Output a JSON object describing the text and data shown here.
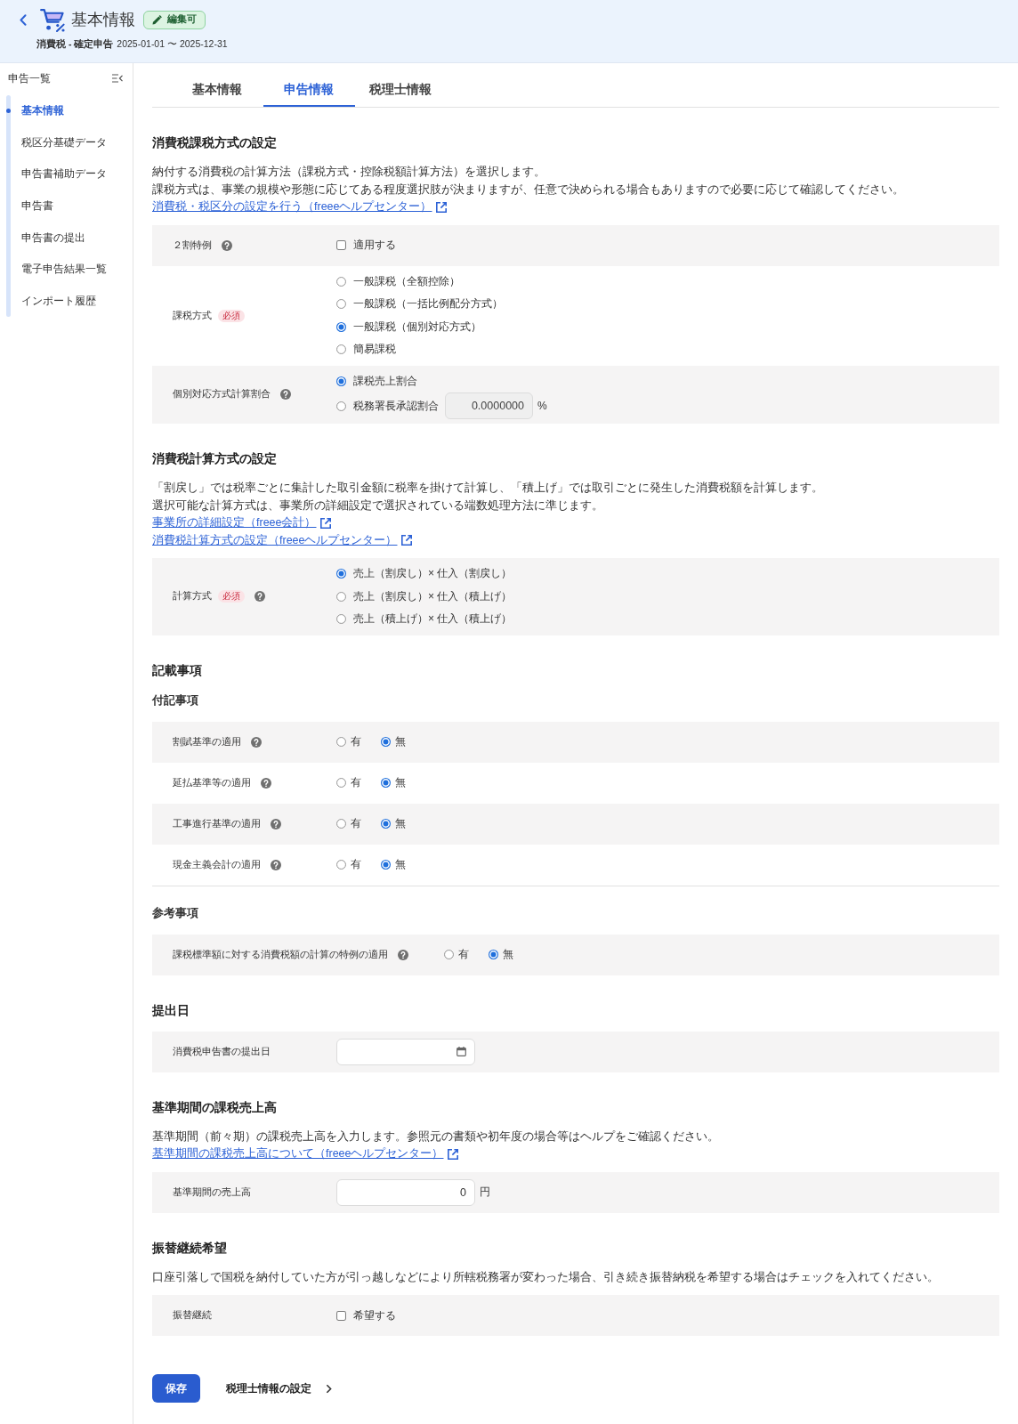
{
  "header": {
    "title": "基本情報",
    "badge": "編集可",
    "return_type": "消費税 - 確定申告",
    "period": "2025-01-01 〜 2025-12-31"
  },
  "sidebar": {
    "title": "申告一覧",
    "items": [
      {
        "label": "基本情報",
        "selected": true
      },
      {
        "label": "税区分基礎データ",
        "selected": false
      },
      {
        "label": "申告書補助データ",
        "selected": false
      },
      {
        "label": "申告書",
        "selected": false
      },
      {
        "label": "申告書の提出",
        "selected": false
      },
      {
        "label": "電子申告結果一覧",
        "selected": false
      },
      {
        "label": "インポート履歴",
        "selected": false
      }
    ]
  },
  "tabs": [
    {
      "label": "基本情報",
      "selected": false
    },
    {
      "label": "申告情報",
      "selected": true
    },
    {
      "label": "税理士情報",
      "selected": false
    }
  ],
  "sections": [
    {
      "title": "消費税課税方式の設定",
      "description": [
        "納付する消費税の計算方法（課税方式・控除税額計算方法）を選択します。",
        "課税方式は、事業の規模や形態に応じてある程度選択肢が決まりますが、任意で決められる場合もありますので必要に応じて確認してください。"
      ],
      "links": [
        "消費税・税区分の設定を行う（freeeヘルプセンター）"
      ],
      "rows": [
        {
          "kind": "checkbox",
          "label": "２割特例",
          "help": true,
          "option": "適用する",
          "checked": false
        },
        {
          "kind": "radio",
          "label": "課税方式",
          "badge": "必須",
          "help": false,
          "options": [
            {
              "label": "一般課税（全額控除）",
              "selected": false
            },
            {
              "label": "一般課税（一括比例配分方式）",
              "selected": false
            },
            {
              "label": "一般課税（個別対応方式）",
              "selected": true
            },
            {
              "label": "簡易課税",
              "selected": false
            }
          ]
        },
        {
          "kind": "radio",
          "label": "個別対応方式計算割合",
          "help": true,
          "options": [
            {
              "label": "課税売上割合",
              "selected": true
            },
            {
              "label": "税務署長承認割合",
              "selected": false,
              "input": {
                "value": "0.0000000",
                "unit": "%",
                "disabled": true
              }
            }
          ]
        }
      ]
    },
    {
      "title": "消費税計算方式の設定",
      "description": [
        "「割戻し」では税率ごとに集計した取引金額に税率を掛けて計算し、「積上げ」では取引ごとに発生した消費税額を計算します。",
        "選択可能な計算方式は、事業所の詳細設定で選択されている端数処理方法に準じます。"
      ],
      "links": [
        "事業所の詳細設定（freee会計）",
        "消費税計算方式の設定（freeeヘルプセンター）"
      ],
      "rows": [
        {
          "kind": "radio",
          "label": "計算方式",
          "badge": "必須",
          "help": true,
          "options": [
            {
              "label": "売上（割戻し）× 仕入（割戻し）",
              "selected": true
            },
            {
              "label": "売上（割戻し）× 仕入（積上げ）",
              "selected": false
            },
            {
              "label": "売上（積上げ）× 仕入（積上げ）",
              "selected": false
            }
          ]
        }
      ]
    },
    {
      "title": "記載事項",
      "groups": [
        {
          "title": "付記事項",
          "rows": [
            {
              "kind": "radio_inline",
              "label": "割賦基準の適用",
              "help": true,
              "options": [
                {
                  "label": "有",
                  "selected": false
                },
                {
                  "label": "無",
                  "selected": true
                }
              ]
            },
            {
              "kind": "radio_inline",
              "label": "延払基準等の適用",
              "help": true,
              "options": [
                {
                  "label": "有",
                  "selected": false
                },
                {
                  "label": "無",
                  "selected": true
                }
              ]
            },
            {
              "kind": "radio_inline",
              "label": "工事進行基準の適用",
              "help": true,
              "options": [
                {
                  "label": "有",
                  "selected": false
                },
                {
                  "label": "無",
                  "selected": true
                }
              ]
            },
            {
              "kind": "radio_inline",
              "label": "現金主義会計の適用",
              "help": true,
              "options": [
                {
                  "label": "有",
                  "selected": false
                },
                {
                  "label": "無",
                  "selected": true
                }
              ]
            }
          ]
        },
        {
          "title": "参考事項",
          "rows": [
            {
              "kind": "radio_inline",
              "label": "課税標準額に対する消費税額の計算の特例の適用",
              "help": true,
              "options": [
                {
                  "label": "有",
                  "selected": false
                },
                {
                  "label": "無",
                  "selected": true
                }
              ]
            }
          ]
        }
      ]
    },
    {
      "title": "提出日",
      "rows": [
        {
          "kind": "date",
          "label": "消費税申告書の提出日",
          "help": false
        }
      ]
    },
    {
      "title": "基準期間の課税売上高",
      "description": [
        "基準期間（前々期）の課税売上高を入力します。参照元の書類や初年度の場合等はヘルプをご確認ください。"
      ],
      "links": [
        "基準期間の課税売上高について（freeeヘルプセンター）"
      ],
      "rows": [
        {
          "kind": "amount",
          "label": "基準期間の売上高",
          "help": false,
          "value": "0",
          "unit": "円"
        }
      ]
    },
    {
      "title": "振替継続希望",
      "description": [
        "口座引落しで国税を納付していた方が引っ越しなどにより所轄税務署が変わった場合、引き続き振替納税を希望する場合はチェックを入れてください。"
      ],
      "rows": [
        {
          "kind": "checkbox",
          "label": "振替継続",
          "help": false,
          "option": "希望する",
          "checked": false
        }
      ]
    }
  ],
  "footer": {
    "save_button": "保存",
    "next_link": "税理士情報の設定"
  }
}
